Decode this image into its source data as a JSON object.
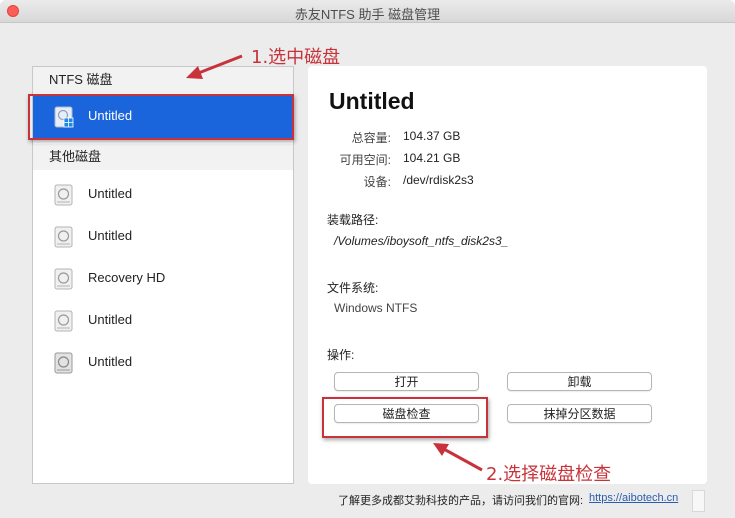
{
  "window": {
    "title": "赤友NTFS 助手 磁盘管理"
  },
  "sidebar": {
    "ntfs_header": "NTFS 磁盘",
    "ntfs_disks": [
      {
        "label": "Untitled",
        "selected": true
      }
    ],
    "other_header": "其他磁盘",
    "other_disks": [
      {
        "label": "Untitled"
      },
      {
        "label": "Untitled"
      },
      {
        "label": "Recovery HD"
      },
      {
        "label": "Untitled"
      },
      {
        "label": "Untitled"
      }
    ]
  },
  "detail": {
    "name": "Untitled",
    "props": [
      {
        "label": "总容量:",
        "value": "104.37 GB"
      },
      {
        "label": "可用空间:",
        "value": "104.21 GB"
      },
      {
        "label": "设备:",
        "value": "/dev/rdisk2s3"
      }
    ],
    "mount_label": "装载路径:",
    "mount_path": "/Volumes/iboysoft_ntfs_disk2s3_",
    "fs_label": "文件系统:",
    "fs_value": "Windows NTFS",
    "ops_label": "操作:",
    "buttons": {
      "open": "打开",
      "unmount": "卸载",
      "check": "磁盘检查",
      "wipe": "抹掉分区数据"
    }
  },
  "annotations": {
    "step1": "1.选中磁盘",
    "step2": "2.选择磁盘检查",
    "color": "#c8323a"
  },
  "footer": {
    "text": "了解更多成都艾勃科技的产品，请访问我们的官网:",
    "link": "https://aibotech.cn"
  },
  "colors": {
    "selection": "#1a64dc",
    "close_button": "#fd5d57",
    "link": "#2a5db0"
  }
}
